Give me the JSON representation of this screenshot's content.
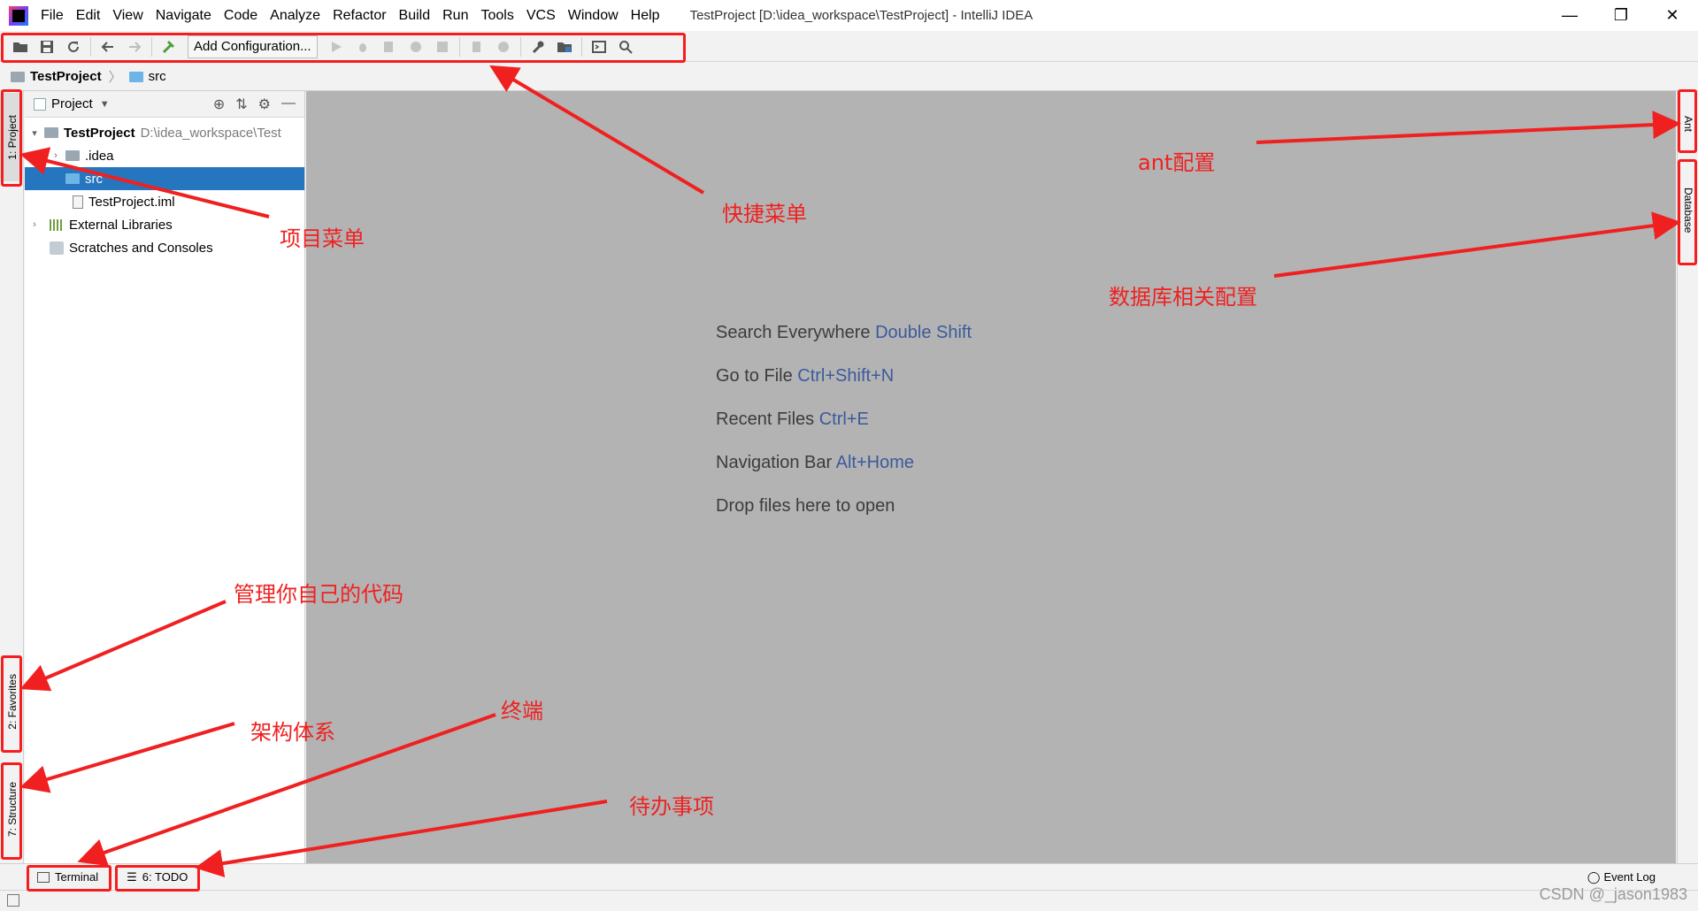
{
  "titlebar": {
    "menus": [
      "File",
      "Edit",
      "View",
      "Navigate",
      "Code",
      "Analyze",
      "Refactor",
      "Build",
      "Run",
      "Tools",
      "VCS",
      "Window",
      "Help"
    ],
    "window_title": "TestProject [D:\\idea_workspace\\TestProject] - IntelliJ IDEA",
    "minimize": "—",
    "restore": "❐",
    "close": "✕"
  },
  "toolbar": {
    "add_config_label": "Add Configuration..."
  },
  "breadcrumb": {
    "project": "TestProject",
    "folder": "src"
  },
  "left_tabs": {
    "project": "1: Project",
    "favorites": "2: Favorites",
    "structure": "7: Structure"
  },
  "project_panel": {
    "title": "Project",
    "tree": {
      "root_name": "TestProject",
      "root_path": "D:\\idea_workspace\\Test",
      "idea": ".idea",
      "src": "src",
      "iml": "TestProject.iml",
      "libraries": "External Libraries",
      "scratches": "Scratches and Consoles"
    }
  },
  "editor_hints": [
    {
      "label": "Search Everywhere",
      "key": "Double Shift"
    },
    {
      "label": "Go to File",
      "key": "Ctrl+Shift+N"
    },
    {
      "label": "Recent Files",
      "key": "Ctrl+E"
    },
    {
      "label": "Navigation Bar",
      "key": "Alt+Home"
    },
    {
      "label": "Drop files here to open",
      "key": ""
    }
  ],
  "right_tabs": {
    "ant": "Ant",
    "database": "Database"
  },
  "bottom_tabs": {
    "terminal": "Terminal",
    "todo": "6: TODO",
    "event_log": "Event Log"
  },
  "annotations": {
    "shortcut_menu": "快捷菜单",
    "project_menu": "项目菜单",
    "ant_config": "ant配置",
    "database_config": "数据库相关配置",
    "manage_code": "管理你自己的代码",
    "structure": "架构体系",
    "terminal": "终端",
    "todo": "待办事项"
  },
  "watermark": "CSDN @_jason1983",
  "colors": {
    "annotation_red": "#f02020",
    "selection_blue": "#2675bf",
    "editor_gray": "#b3b3b3",
    "shortcut_blue": "#3c5a9c"
  }
}
